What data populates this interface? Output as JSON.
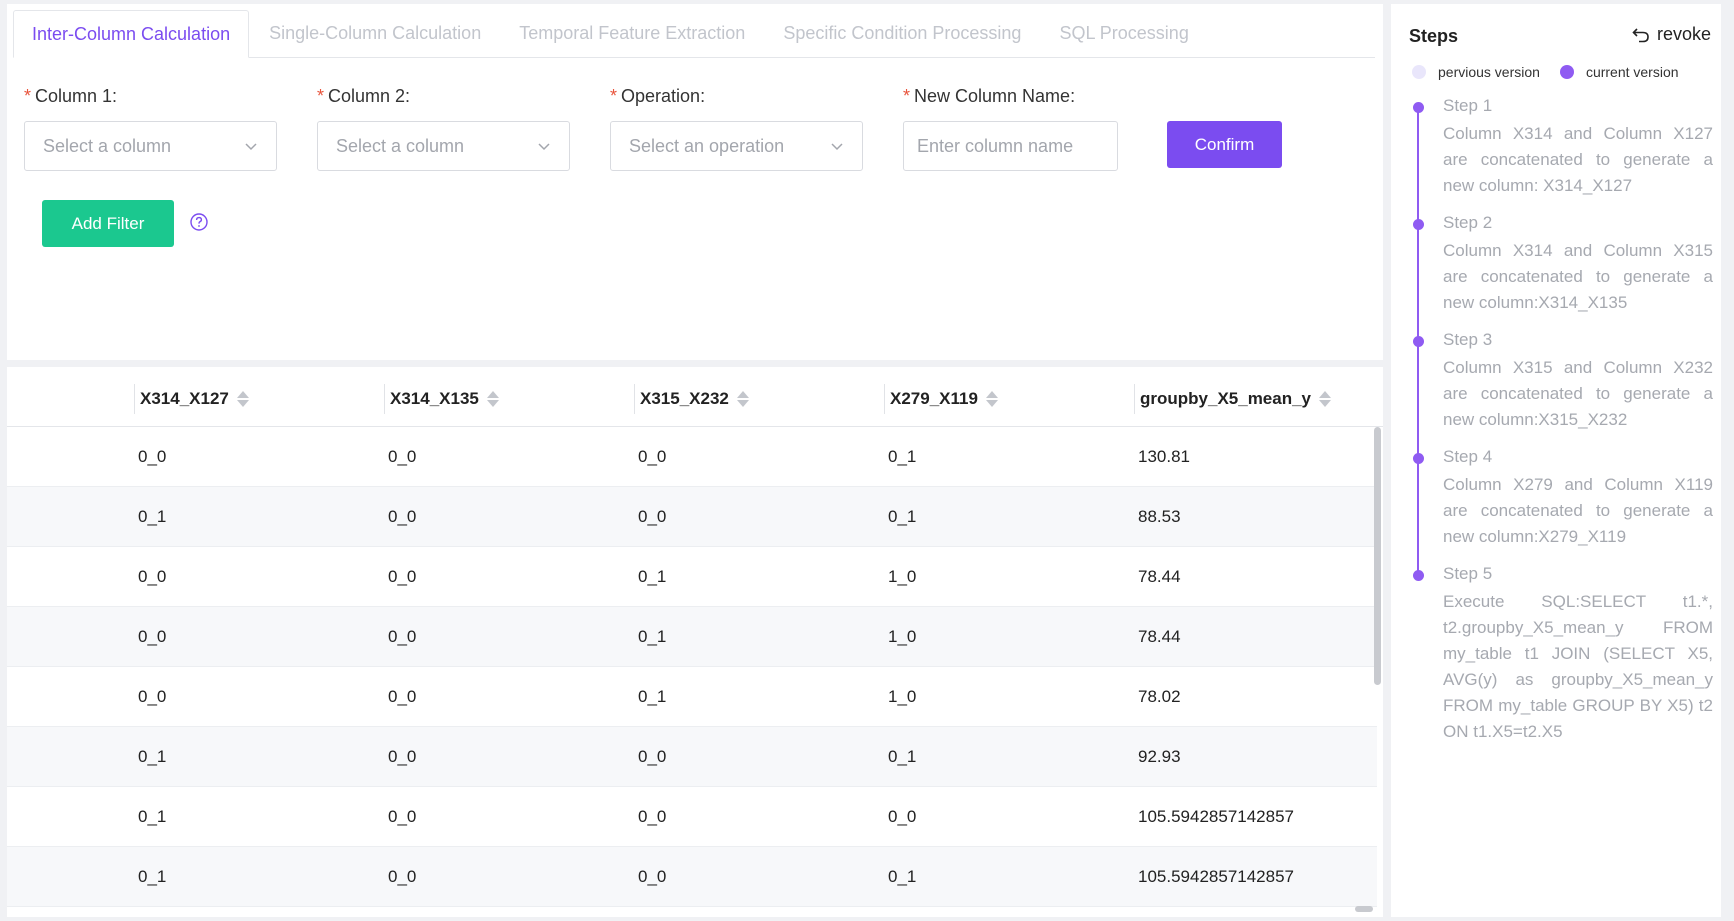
{
  "tabs": [
    {
      "label": "Inter-Column Calculation",
      "active": true
    },
    {
      "label": "Single-Column Calculation",
      "active": false
    },
    {
      "label": "Temporal Feature Extraction",
      "active": false
    },
    {
      "label": "Specific Condition Processing",
      "active": false
    },
    {
      "label": "SQL Processing",
      "active": false
    }
  ],
  "form": {
    "column1": {
      "label": "Column 1:",
      "placeholder": "Select a column"
    },
    "column2": {
      "label": "Column 2:",
      "placeholder": "Select a column"
    },
    "operation": {
      "label": "Operation:",
      "placeholder": "Select an operation"
    },
    "new_name": {
      "label": "New Column Name:",
      "placeholder": "Enter column name"
    },
    "required_mark": "*",
    "confirm_label": "Confirm",
    "add_filter_label": "Add Filter"
  },
  "table": {
    "columns": [
      "X314_X127",
      "X314_X135",
      "X315_X232",
      "X279_X119",
      "groupby_X5_mean_y"
    ],
    "rows": [
      [
        "0_0",
        "0_0",
        "0_0",
        "0_1",
        "130.81"
      ],
      [
        "0_1",
        "0_0",
        "0_0",
        "0_1",
        "88.53"
      ],
      [
        "0_0",
        "0_0",
        "0_1",
        "1_0",
        "78.44"
      ],
      [
        "0_0",
        "0_0",
        "0_1",
        "1_0",
        "78.44"
      ],
      [
        "0_0",
        "0_0",
        "0_1",
        "1_0",
        "78.02"
      ],
      [
        "0_1",
        "0_0",
        "0_0",
        "0_1",
        "92.93"
      ],
      [
        "0_1",
        "0_0",
        "0_0",
        "0_0",
        "105.5942857142857"
      ],
      [
        "0_1",
        "0_0",
        "0_0",
        "0_1",
        "105.5942857142857"
      ]
    ]
  },
  "steps_panel": {
    "title": "Steps",
    "revoke_label": "revoke",
    "legend_previous": "pervious version",
    "legend_current": "current version",
    "accent_color": "#8f5bf2",
    "steps": [
      {
        "title": "Step 1",
        "desc": "Column X314 and Column X127 are concatenated to generate a new column: X314_X127"
      },
      {
        "title": "Step 2",
        "desc": "Column X314 and Column X315 are concatenated to generate a new column:X314_X135"
      },
      {
        "title": "Step 3",
        "desc": "Column X315 and Column X232 are concatenated to generate a new column:X315_X232"
      },
      {
        "title": "Step 4",
        "desc": "Column X279 and Column X119 are concatenated to generate a new column:X279_X119"
      },
      {
        "title": "Step 5",
        "desc": "Execute SQL:SELECT t1.*, t2.groupby_X5_mean_y FROM my_table t1 JOIN (SELECT X5, AVG(y) as groupby_X5_mean_y FROM my_table GROUP BY X5) t2 ON t1.X5=t2.X5"
      }
    ]
  },
  "colors": {
    "primary": "#7b4cf0",
    "success": "#1bc88f",
    "required": "#e8543c"
  }
}
